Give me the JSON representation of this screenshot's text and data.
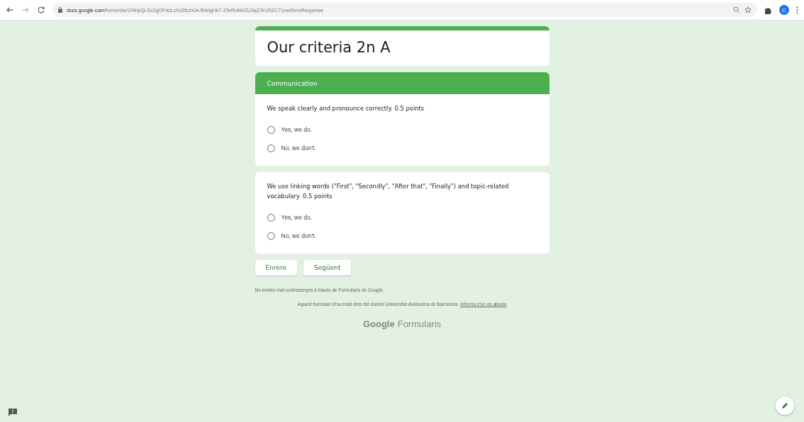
{
  "browser": {
    "url_host": "docs.google.com",
    "url_path": "/forms/d/e/1FAIpQLSc2gOFdcLzXd26cbUeJ64dgHk7-3TeRoNKZU3qZJKV9ZC71nw/formResponse",
    "avatar": "C"
  },
  "form": {
    "title": "Our criteria 2n A",
    "sections": [
      {
        "header": "Communication",
        "questions": [
          {
            "text": "We speak clearly and pronounce correctly. 0.5 points",
            "options": [
              {
                "label": "Yes, we do.",
                "selected": false
              },
              {
                "label": "No, we don't.",
                "selected": false
              }
            ]
          }
        ]
      },
      {
        "questions": [
          {
            "text": "We use linking words (\"First\", \"Secondly\", \"After that\", \"Finally\") and topic-related vocabulary. 0.5 points",
            "options": [
              {
                "label": "Yes, we do.",
                "selected": false
              },
              {
                "label": "No, we don't.",
                "selected": false
              }
            ]
          }
        ]
      }
    ],
    "buttons": [
      "Enrere",
      "Següent"
    ],
    "password_warning": "No envieu mai contrasenyes a través de Formularis de Google.",
    "domain_note": "Aquest formulari s'ha creat dins del domini Universitat Autònoma de Barcelona.",
    "abuse_link": "Informa d'un ús abusiu",
    "logo_brand": "Google",
    "logo_product": "Formularis"
  }
}
